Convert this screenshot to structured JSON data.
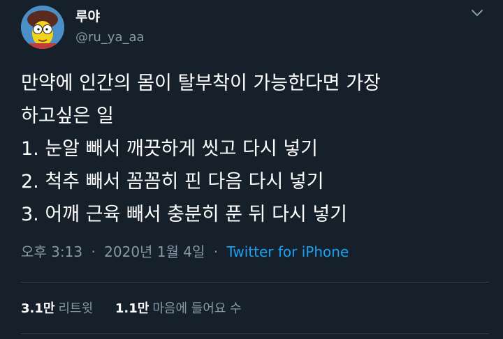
{
  "author": {
    "display_name": "루야",
    "handle": "@ru_ya_aa",
    "avatar_icon": "cartoon-avatar"
  },
  "tweet": {
    "lines": [
      "만약에 인간의 몸이 탈부착이 가능한다면 가장",
      "하고싶은 일",
      "1. 눈알 빼서 깨끗하게 씻고 다시 넣기",
      "2. 척추 빼서 꼼꼼히 핀 다음 다시 넣기",
      "3. 어깨 근육 빼서 충분히 푼 뒤 다시 넣기"
    ]
  },
  "meta": {
    "time": "오후 3:13",
    "date": "2020년 1월 4일",
    "separator": "·",
    "source": "Twitter for iPhone"
  },
  "stats": {
    "retweets_count": "3.1만",
    "retweets_label": "리트윗",
    "likes_count": "1.1만",
    "likes_label": "마음에 들어요 수"
  },
  "colors": {
    "background": "#15202b",
    "text": "#ffffff",
    "muted": "#8899a6",
    "link": "#1da1f2",
    "divider": "#38444d"
  }
}
